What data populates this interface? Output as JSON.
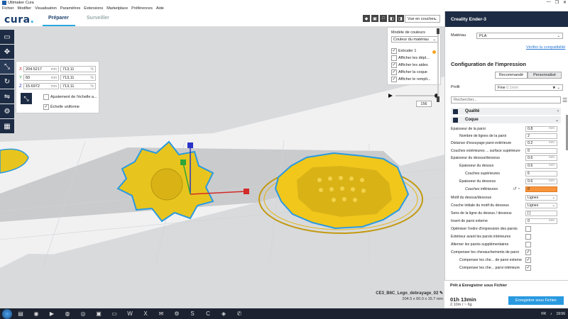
{
  "window": {
    "title": "Ultimaker Cura",
    "controls": [
      "—",
      "❐",
      "✕"
    ]
  },
  "menu": [
    "Fichier",
    "Modifier",
    "Visualisation",
    "Paramètres",
    "Extensions",
    "Marketplace",
    "Préférences",
    "Aide"
  ],
  "header": {
    "logo": "cura",
    "tabs": [
      "Préparer",
      "Surveiller"
    ],
    "active_tab": "Préparer"
  },
  "scale_panel": {
    "x": {
      "label": "X",
      "mm": "204.5217",
      "unit": "mm",
      "pct": "713,11",
      "pct_unit": "%"
    },
    "y": {
      "label": "Y",
      "mm": "60",
      "unit": "mm",
      "pct": "713,11",
      "pct_unit": "%"
    },
    "z": {
      "label": "Z",
      "mm": "15.6972",
      "unit": "mm",
      "pct": "713,11",
      "pct_unit": "%"
    },
    "auto_drop_label": "Ajustement de l'échelle a...",
    "uniform_label": "Échelle uniforme",
    "uniform_checked": "✓"
  },
  "view": {
    "dropdown": "Vue en couches"
  },
  "color_panel": {
    "title": "Modèle de couleurs",
    "scheme": "Couleur du matériau",
    "items": [
      "Extruder 1",
      "Afficher les dépl...",
      "Afficher les aides",
      "Afficher la coque",
      "Afficher le rempli..."
    ],
    "checks": [
      "✓",
      "",
      "✓",
      "✓",
      "✓"
    ],
    "extruder_color": "#f5a623"
  },
  "layer": {
    "value": "156"
  },
  "object": {
    "name": "CE3_B6C_Lego_debrayage_02",
    "dims": "204.5 x 60.0 x 15.7 mm"
  },
  "right": {
    "printer": "Creality Ender-3",
    "material_label": "Matériau",
    "material_value": "PLA",
    "compat_link": "Vérifier la compatibilité",
    "config_title": "Configuration de l'impression",
    "mode_recommended": "Recommandé",
    "mode_custom": "Personnalisé",
    "profile_label": "Profil",
    "profile_value": "Fine",
    "profile_sub": "0.1mm",
    "search_placeholder": "Rechercher...",
    "cat_quality": "Qualité",
    "cat_shell": "Coque",
    "settings": [
      {
        "name": "Épaisseur de la paroi",
        "value": "0.8",
        "unit": "mm"
      },
      {
        "name": "Nombre de lignes de la paroi",
        "value": "2",
        "unit": ""
      },
      {
        "name": "Distance d'essuyage paroi extérieure",
        "value": "0.2",
        "unit": "mm"
      },
      {
        "name": "Couches extérieures ... surface supérieure",
        "value": "0",
        "unit": ""
      },
      {
        "name": "Épaisseur du dessus/dessous",
        "value": "0.6",
        "unit": "mm"
      },
      {
        "name": "Épaisseur du dessus",
        "value": "0.6",
        "unit": "mm"
      },
      {
        "name": "Couches supérieures",
        "value": "6",
        "unit": ""
      },
      {
        "name": "Épaisseur du dessous",
        "value": "0.6",
        "unit": "mm"
      },
      {
        "name": "Couches inférieures",
        "value": "0",
        "unit": ""
      },
      {
        "name": "Motif du dessus/dessous",
        "value": "Lignes",
        "unit": ""
      },
      {
        "name": "Couche initiale du motif du dessous",
        "value": "Lignes",
        "unit": ""
      },
      {
        "name": "Sens de la ligne du dessus / dessous",
        "value": "[ ]",
        "unit": ""
      },
      {
        "name": "Insert de paroi externe",
        "value": "0",
        "unit": "mm"
      },
      {
        "name": "Optimiser l'ordre d'impression des parois",
        "value": "",
        "unit": ""
      },
      {
        "name": "Extérieur avant les parois intérieures",
        "value": "",
        "unit": ""
      },
      {
        "name": "Alterner les parois supplémentaires",
        "value": "",
        "unit": ""
      },
      {
        "name": "Compenser les chevauchements de paroi",
        "value": "✓",
        "unit": ""
      },
      {
        "name": "Compenser les che... de paroi externe",
        "value": "✓",
        "unit": ""
      },
      {
        "name": "Compenser les che... paroi intérieure",
        "value": "✓",
        "unit": ""
      }
    ],
    "output_title": "Prêt à Enregistrer sous Fichier",
    "time": "01h 13min",
    "material_usage": "2.10m / ~ 6g",
    "save_button": "Enregistrer sous Fichier"
  },
  "taskbar": {
    "lang": "FR",
    "time": "19:56"
  }
}
